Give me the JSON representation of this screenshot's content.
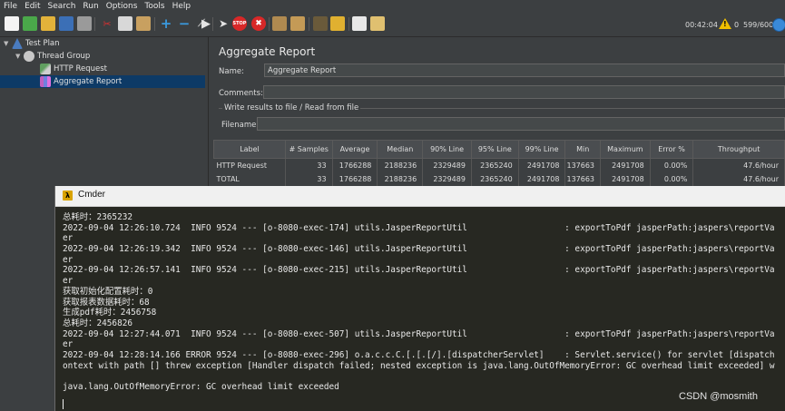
{
  "menu": [
    "File",
    "Edit",
    "Search",
    "Run",
    "Options",
    "Tools",
    "Help"
  ],
  "toolbar_icons": [
    "new-icon",
    "templates-icon",
    "open-icon",
    "save-icon",
    "save-as-icon",
    "cut-icon",
    "copy-icon",
    "paste-icon",
    "expand-icon",
    "collapse-icon",
    "toggle-icon",
    "start-icon",
    "start-no-pauses-icon",
    "stop-icon",
    "shutdown-icon",
    "clear-icon",
    "clear-all-icon",
    "search-icon",
    "reset-search-icon",
    "function-helper-icon",
    "help-icon"
  ],
  "status": {
    "elapsed": "00:42:04",
    "warnings": "0",
    "threads": "599/600"
  },
  "tree": [
    {
      "label": "Test Plan"
    },
    {
      "label": "Thread Group"
    },
    {
      "label": "HTTP Request"
    },
    {
      "label": "Aggregate Report"
    }
  ],
  "panel": {
    "title": "Aggregate Report",
    "name_label": "Name:",
    "name_value": "Aggregate Report",
    "comments_label": "Comments:",
    "comments_value": "",
    "group_label": "Write results to file / Read from file",
    "filename_label": "Filename",
    "filename_value": ""
  },
  "table": {
    "headers": [
      "Label",
      "# Samples",
      "Average",
      "Median",
      "90% Line",
      "95% Line",
      "99% Line",
      "Min",
      "Maximum",
      "Error %",
      "Throughput"
    ],
    "rows": [
      [
        "HTTP Request",
        "33",
        "1766288",
        "2188236",
        "2329489",
        "2365240",
        "2491708",
        "137663",
        "2491708",
        "0.00%",
        "47.6/hour"
      ],
      [
        "TOTAL",
        "33",
        "1766288",
        "2188236",
        "2329489",
        "2365240",
        "2491708",
        "137663",
        "2491708",
        "0.00%",
        "47.6/hour"
      ]
    ]
  },
  "cmder": {
    "title": "Cmder",
    "lines": [
      "总耗时：2365232",
      "2022-09-04 12:26:10.724  INFO 9524 --- [o-8080-exec-174] utils.JasperReportUtil                   : exportToPdf jasperPath:jaspers\\reportVa",
      "er",
      "2022-09-04 12:26:19.342  INFO 9524 --- [o-8080-exec-146] utils.JasperReportUtil                   : exportToPdf jasperPath:jaspers\\reportVa",
      "er",
      "2022-09-04 12:26:57.141  INFO 9524 --- [o-8080-exec-215] utils.JasperReportUtil                   : exportToPdf jasperPath:jaspers\\reportVa",
      "er",
      "获取初始化配置耗时：0",
      "获取报表数据耗时：68",
      "生成pdf耗时：2456758",
      "总耗时：2456826",
      "2022-09-04 12:27:44.071  INFO 9524 --- [o-8080-exec-507] utils.JasperReportUtil                   : exportToPdf jasperPath:jaspers\\reportVa",
      "er",
      "2022-09-04 12:28:14.166 ERROR 9524 --- [o-8080-exec-296] o.a.c.c.C.[.[.[/].[dispatcherServlet]    : Servlet.service() for servlet [dispatch",
      "ontext with path [] threw exception [Handler dispatch failed; nested exception is java.lang.OutOfMemoryError: GC overhead limit exceeded] w",
      "",
      "java.lang.OutOfMemoryError: GC overhead limit exceeded"
    ]
  },
  "watermark": "CSDN @mosmith"
}
